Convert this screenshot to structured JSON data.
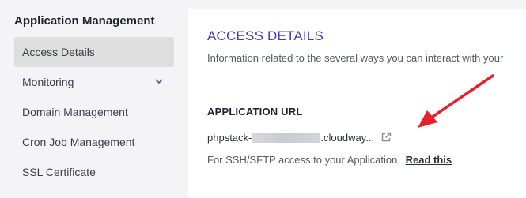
{
  "sidebar": {
    "title": "Application Management",
    "items": [
      {
        "label": "Access Details",
        "active": true
      },
      {
        "label": "Monitoring",
        "has_chevron": true
      },
      {
        "label": "Domain Management"
      },
      {
        "label": "Cron Job Management"
      },
      {
        "label": "SSL Certificate"
      }
    ]
  },
  "main": {
    "title": "ACCESS DETAILS",
    "description": "Information related to the several ways you can interact with your",
    "app_url_label": "APPLICATION URL",
    "url_prefix": "phpstack-",
    "url_suffix": ".cloudway...",
    "ssh_text": "For SSH/SFTP access to your Application.",
    "read_link": "Read this"
  },
  "colors": {
    "accent": "#3b3fc4",
    "annotation_arrow": "#e8202a",
    "active_item_bg": "#dededf"
  },
  "icons": {
    "chevron": "chevron-down-icon",
    "external": "external-link-icon"
  }
}
